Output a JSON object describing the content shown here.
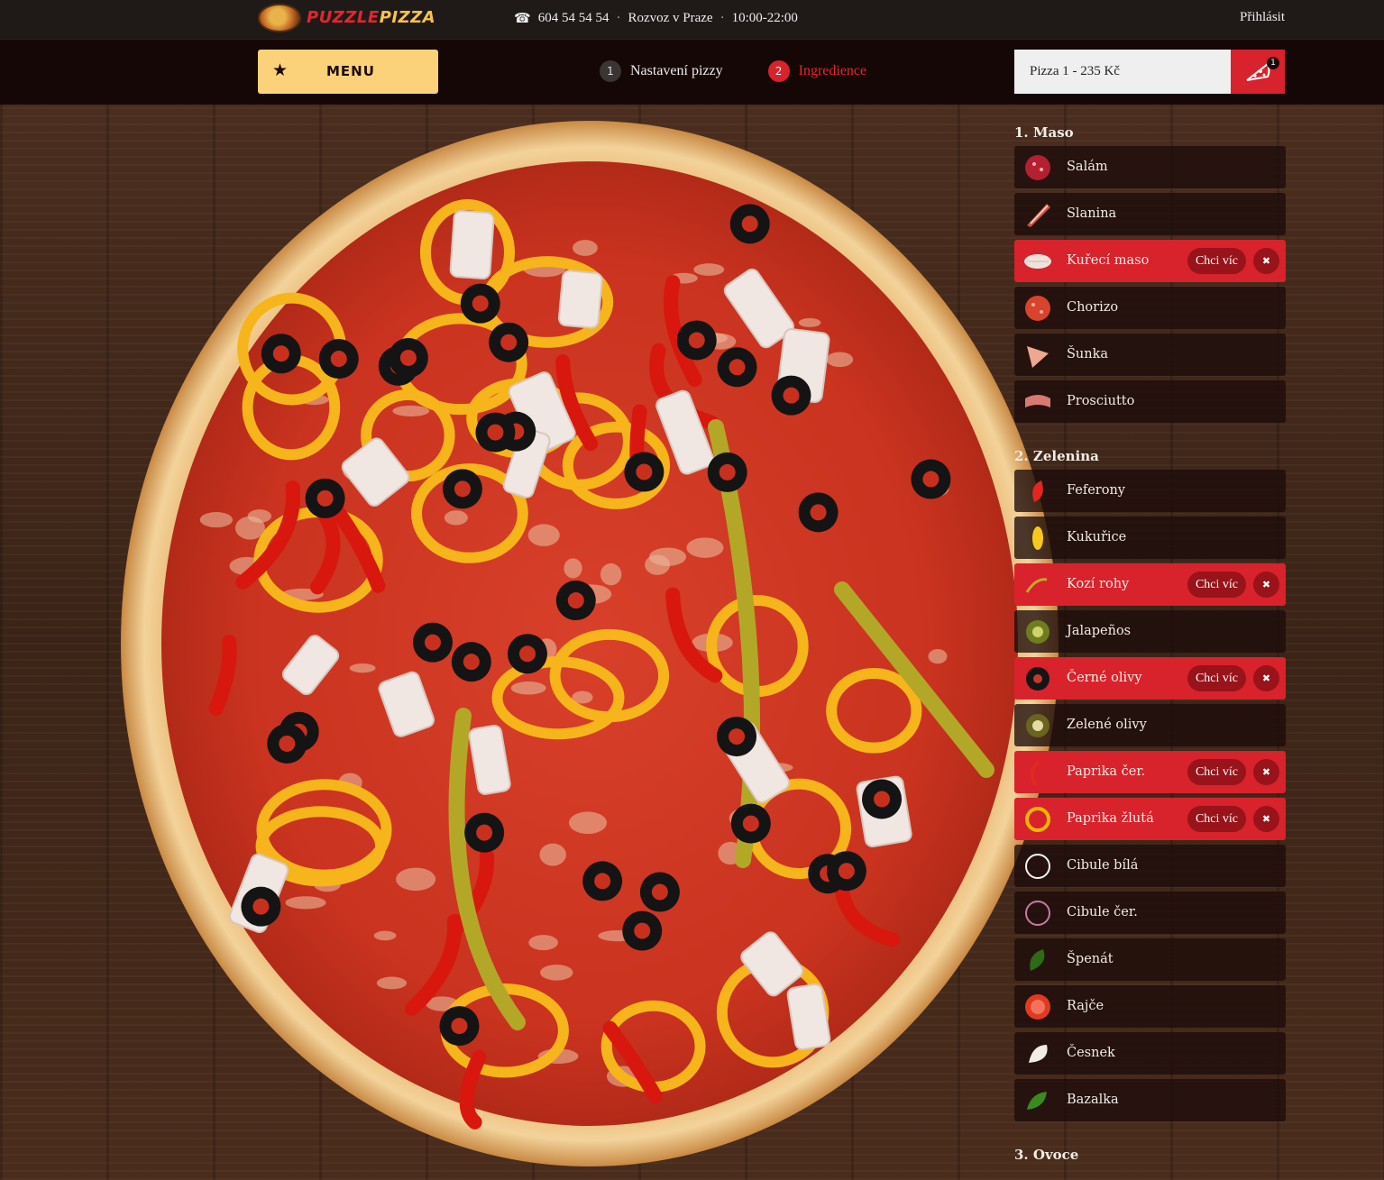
{
  "header": {
    "brand_part1": "PUZZLE",
    "brand_part2": "PIZZA",
    "phone": "604 54 54 54",
    "delivery": "Rozvoz v Praze",
    "hours": "10:00-22:00",
    "separator": "·",
    "login": "Přihlásit"
  },
  "nav": {
    "menu_label": "MENU",
    "steps": [
      {
        "number": "1",
        "label": "Nastavení pizzy",
        "state": "done"
      },
      {
        "number": "2",
        "label": "Ingredience",
        "state": "active"
      }
    ],
    "cart_summary": "Pizza 1 - 235 Kč",
    "cart_count": "1"
  },
  "ingredients": {
    "more_label": "Chci víc",
    "remove_label": "✖",
    "categories": [
      {
        "title": "1. Maso",
        "items": [
          {
            "name": "Salám",
            "icon": "salami-icon",
            "selected": false
          },
          {
            "name": "Slanina",
            "icon": "bacon-icon",
            "selected": false
          },
          {
            "name": "Kuřecí maso",
            "icon": "chicken-icon",
            "selected": true
          },
          {
            "name": "Chorizo",
            "icon": "chorizo-icon",
            "selected": false
          },
          {
            "name": "Šunka",
            "icon": "ham-icon",
            "selected": false
          },
          {
            "name": "Prosciutto",
            "icon": "prosciutto-icon",
            "selected": false
          }
        ]
      },
      {
        "title": "2. Zelenina",
        "items": [
          {
            "name": "Feferony",
            "icon": "chili-icon",
            "selected": false
          },
          {
            "name": "Kukuřice",
            "icon": "corn-icon",
            "selected": false
          },
          {
            "name": "Kozí rohy",
            "icon": "green-pepper-icon",
            "selected": true
          },
          {
            "name": "Jalapeños",
            "icon": "jalapeno-icon",
            "selected": false
          },
          {
            "name": "Černé olivy",
            "icon": "black-olive-icon",
            "selected": true
          },
          {
            "name": "Zelené olivy",
            "icon": "green-olive-icon",
            "selected": false
          },
          {
            "name": "Paprika čer.",
            "icon": "red-pepper-icon",
            "selected": true
          },
          {
            "name": "Paprika žlutá",
            "icon": "yellow-pepper-icon",
            "selected": true
          },
          {
            "name": "Cibule bílá",
            "icon": "white-onion-icon",
            "selected": false
          },
          {
            "name": "Cibule čer.",
            "icon": "red-onion-icon",
            "selected": false
          },
          {
            "name": "Špenát",
            "icon": "spinach-icon",
            "selected": false
          },
          {
            "name": "Rajče",
            "icon": "tomato-icon",
            "selected": false
          },
          {
            "name": "Česnek",
            "icon": "garlic-icon",
            "selected": false
          },
          {
            "name": "Bazalka",
            "icon": "basil-icon",
            "selected": false
          }
        ]
      },
      {
        "title": "3. Ovoce",
        "items": []
      }
    ]
  },
  "colors": {
    "accent_red": "#d8222c",
    "menu_yellow": "#fbd27a",
    "topbar": "#1f1a18",
    "navbar": "#160707"
  }
}
